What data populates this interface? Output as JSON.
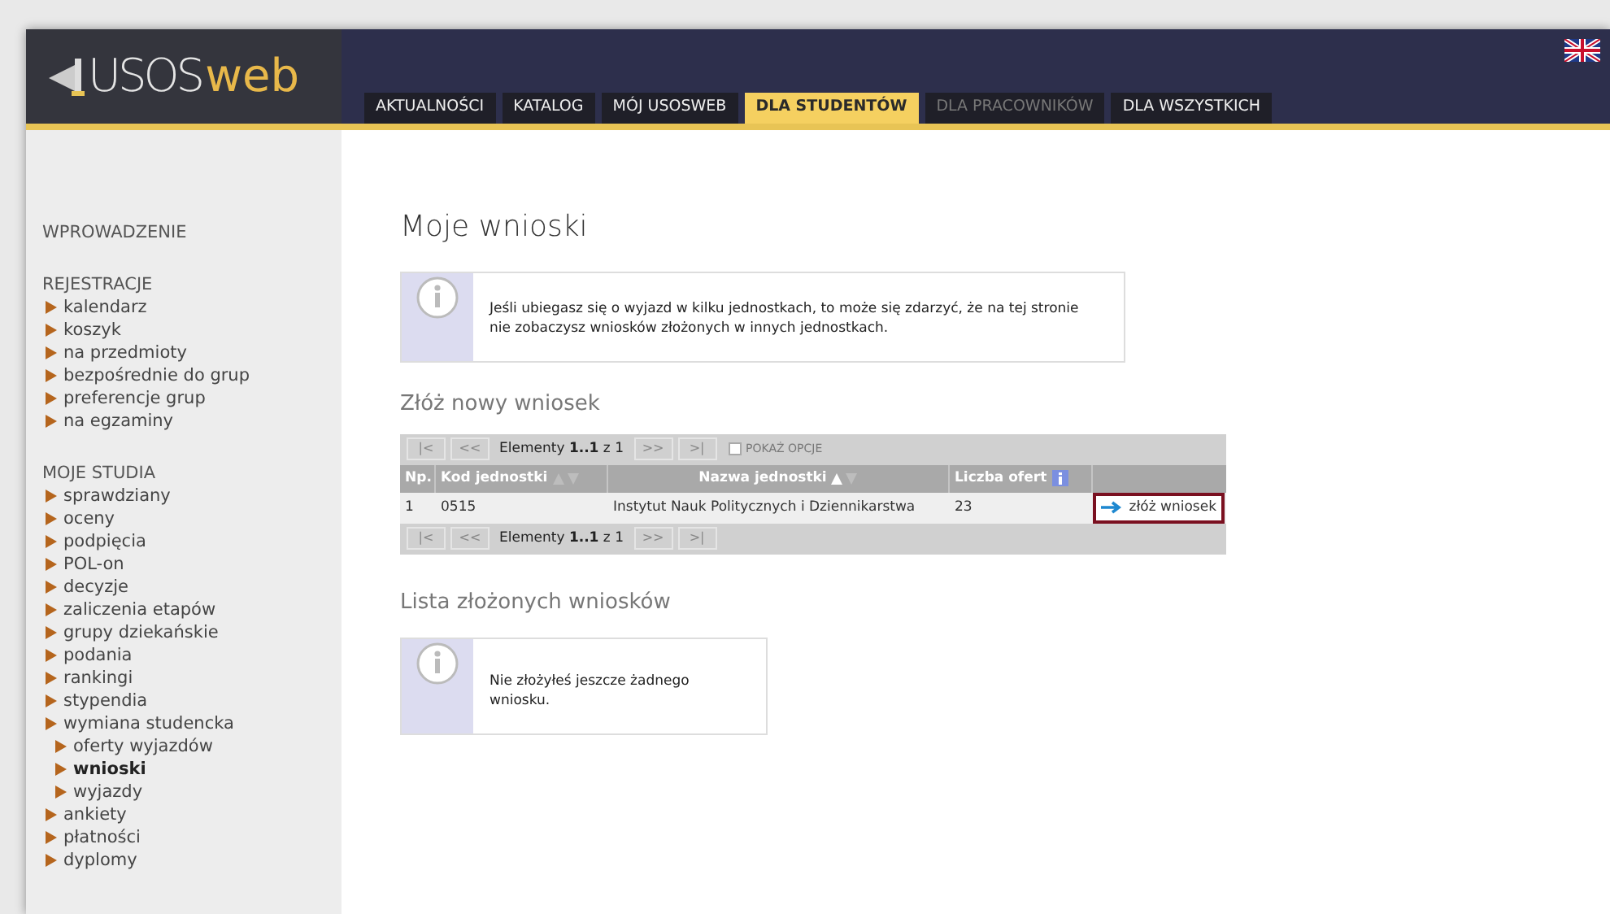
{
  "header": {
    "logo": {
      "prefix": "USOS",
      "suffix": "web"
    },
    "tabs": [
      {
        "label": "AKTUALNOŚCI",
        "selected": false,
        "disabled": false
      },
      {
        "label": "KATALOG",
        "selected": false,
        "disabled": false
      },
      {
        "label": "MÓJ USOSWEB",
        "selected": false,
        "disabled": false
      },
      {
        "label": "DLA STUDENTÓW",
        "selected": true,
        "disabled": false
      },
      {
        "label": "DLA PRACOWNIKÓW",
        "selected": false,
        "disabled": true
      },
      {
        "label": "DLA WSZYSTKICH",
        "selected": false,
        "disabled": false
      }
    ]
  },
  "sidebar": {
    "sections": [
      {
        "heading": "WPROWADZENIE"
      },
      {
        "heading": "REJESTRACJE",
        "items": [
          {
            "label": "kalendarz",
            "selected": false
          },
          {
            "label": "koszyk",
            "selected": false
          },
          {
            "label": "na przedmioty",
            "selected": false
          },
          {
            "label": "bezpośrednie do grup",
            "selected": false
          },
          {
            "label": "preferencje grup",
            "selected": false
          },
          {
            "label": "na egzaminy",
            "selected": false
          }
        ]
      },
      {
        "heading": "MOJE STUDIA",
        "items": [
          {
            "label": "sprawdziany",
            "selected": false
          },
          {
            "label": "oceny",
            "selected": false
          },
          {
            "label": "podpięcia",
            "selected": false
          },
          {
            "label": "POL-on",
            "selected": false
          },
          {
            "label": "decyzje",
            "selected": false
          },
          {
            "label": "zaliczenia etapów",
            "selected": false
          },
          {
            "label": "grupy dziekańskie",
            "selected": false
          },
          {
            "label": "podania",
            "selected": false
          },
          {
            "label": "rankingi",
            "selected": false
          },
          {
            "label": "stypendia",
            "selected": false
          },
          {
            "label": "wymiana studencka",
            "selected": false,
            "children": [
              {
                "label": "oferty wyjazdów",
                "selected": false
              },
              {
                "label": "wnioski",
                "selected": true
              },
              {
                "label": "wyjazdy",
                "selected": false
              }
            ]
          },
          {
            "label": "ankiety",
            "selected": false
          },
          {
            "label": "płatności",
            "selected": false
          },
          {
            "label": "dyplomy",
            "selected": false
          }
        ]
      }
    ]
  },
  "main": {
    "title": "Moje wnioski",
    "info_note": "Jeśli ubiegasz się o wyjazd w kilku jednostkach, to może się zdarzyć, że na tej stronie nie zobaczysz wniosków złożonych w innych jednostkach.",
    "new_section": {
      "title": "Złóż nowy wniosek",
      "table": {
        "pager_top": {
          "buttons": [
            {
              "label": "|<",
              "disabled": true
            },
            {
              "label": "<<",
              "disabled": true
            }
          ],
          "summary": "Elementy **1..1** z 1",
          "buttons_after": [
            {
              "label": ">>",
              "disabled": true
            },
            {
              "label": ">|",
              "disabled": true
            }
          ],
          "options": {
            "label": "POKAŻ OPCJE",
            "checked": false
          }
        },
        "columns": [
          {
            "label": "Np."
          },
          {
            "label": "Kod jednostki",
            "sorted": false
          },
          {
            "label": "Nazwa jednostki",
            "sorted": true
          },
          {
            "label": "Liczba ofert",
            "info": true
          }
        ],
        "rows": [
          {
            "cells": [
              "1",
              "0515",
              "Instytut Nauk Politycznych i Dziennikarstwa",
              "23"
            ],
            "action": "złóż wniosek"
          }
        ],
        "pager_bottom": {
          "buttons": [
            {
              "label": "|<",
              "disabled": true
            },
            {
              "label": "<<",
              "disabled": true
            }
          ],
          "summary": "Elementy **1..1** z 1",
          "buttons_after": [
            {
              "label": ">>",
              "disabled": true
            },
            {
              "label": ">|",
              "disabled": true
            }
          ]
        }
      }
    },
    "list_section": {
      "title": "Lista złożonych wniosków",
      "info_note": "Nie złożyłeś jeszcze żadnego wniosku."
    }
  }
}
